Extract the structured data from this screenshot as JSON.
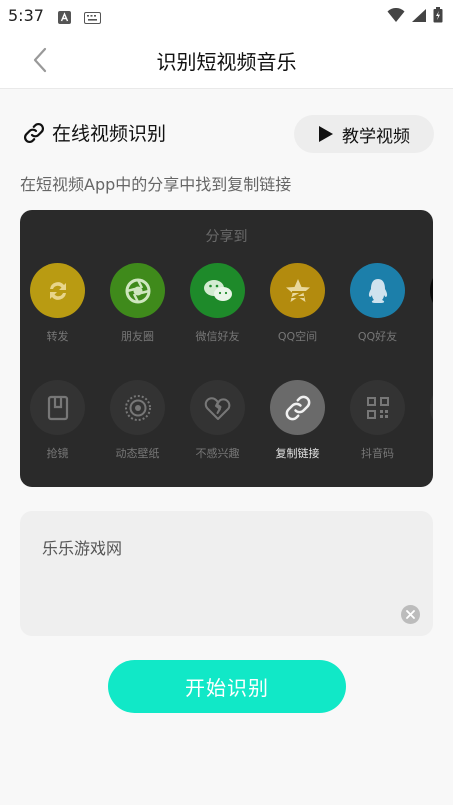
{
  "status_bar": {
    "time": "5:37"
  },
  "header": {
    "title": "识别短视频音乐"
  },
  "section": {
    "title": "在线视频识别",
    "tutorial_label": "教学视频"
  },
  "hint": "在短视频App中的分享中找到复制链接",
  "share_panel": {
    "title": "分享到",
    "row1": [
      {
        "label": "转发",
        "icon": "repost-icon",
        "color": "#b99b12"
      },
      {
        "label": "朋友圈",
        "icon": "moments-icon",
        "color": "#3f8a1b"
      },
      {
        "label": "微信好友",
        "icon": "wechat-icon",
        "color": "#1e8a2a"
      },
      {
        "label": "QQ空间",
        "icon": "qzone-icon",
        "color": "#b38b0e"
      },
      {
        "label": "QQ好友",
        "icon": "qq-icon",
        "color": "#1c7faa"
      }
    ],
    "row2": [
      {
        "label": "抢镜",
        "icon": "grab-shot-icon"
      },
      {
        "label": "动态壁纸",
        "icon": "live-wallpaper-icon"
      },
      {
        "label": "不感兴趣",
        "icon": "broken-heart-icon"
      },
      {
        "label": "复制链接",
        "icon": "link-icon",
        "active": true
      },
      {
        "label": "抖音码",
        "icon": "qr-code-icon"
      }
    ]
  },
  "input": {
    "value": "乐乐游戏网"
  },
  "start_button": {
    "label": "开始识别"
  },
  "colors": {
    "accent": "#11e8c7"
  }
}
